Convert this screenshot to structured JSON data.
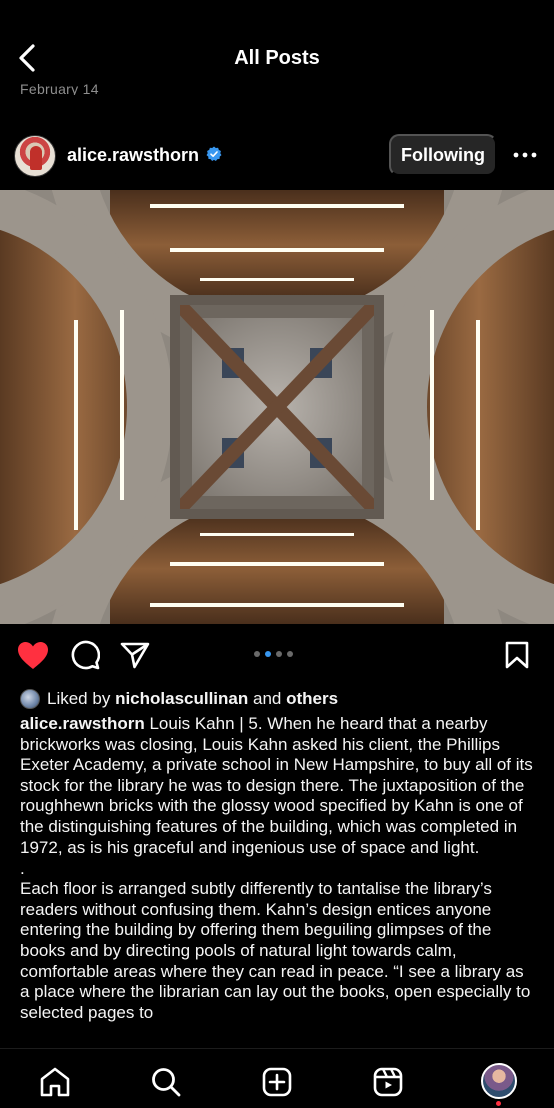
{
  "header": {
    "title": "All Posts",
    "previous_post_date": "February 14"
  },
  "post": {
    "username": "alice.rawsthorn",
    "verified": true,
    "follow_label": "Following",
    "carousel": {
      "total": 4,
      "active_index": 1
    },
    "liked": true,
    "likes": {
      "prefix": "Liked by",
      "user": "nicholascullinan",
      "and": "and",
      "others": "others"
    },
    "caption": {
      "author": "alice.rawsthorn",
      "paragraph1": "Louis Kahn | 5. When he heard that a nearby brickworks was closing, Louis Kahn asked his client, the Phillips Exeter Academy, a private school in New Hampshire, to buy all of its stock for the library he was to design there. The juxtaposition of the roughhewn bricks with the glossy wood specified by Kahn is one of the distinguishing features of the building, which was completed in 1972, as is his graceful and ingenious use of space and light.",
      "separator": ".",
      "paragraph2": "Each floor is arranged subtly differently to tantalise the library’s readers without confusing them. Kahn’s design entices anyone entering the building by offering them beguiling glimpses of the books and by directing pools of natural light towards calm, comfortable areas where they can read in peace. “I see a library as a place where the librarian can lay out the books, open especially to selected pages to"
    }
  },
  "colors": {
    "background": "#000000",
    "like_red": "#ff3040",
    "verified_blue": "#3897f0",
    "carousel_active": "#3897f0"
  },
  "icons": {
    "back": "chevron-left-icon",
    "verified": "verified-badge-icon",
    "more": "more-horizontal-icon",
    "like": "heart-icon",
    "comment": "comment-icon",
    "share": "send-icon",
    "save": "bookmark-icon",
    "tabs": [
      "home-icon",
      "search-icon",
      "create-icon",
      "reels-icon",
      "profile-avatar"
    ]
  }
}
